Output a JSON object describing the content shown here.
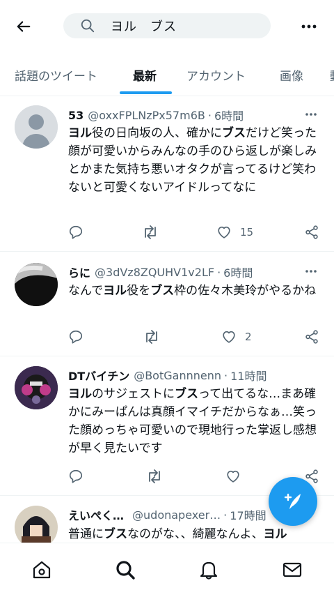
{
  "search": {
    "query": "ヨル　ブス"
  },
  "tabs": [
    {
      "label": "話題のツイート"
    },
    {
      "label": "最新"
    },
    {
      "label": "アカウント"
    },
    {
      "label": "画像"
    },
    {
      "label": "動"
    }
  ],
  "active_tab": "最新",
  "tweets": [
    {
      "name": "53",
      "handle": "@oxxFPLNzPx57m6B",
      "time": "6時間",
      "text_parts": [
        {
          "t": "ヨル",
          "b": true
        },
        {
          "t": "役の日向坂の人、確かに",
          "b": false
        },
        {
          "t": "ブス",
          "b": true
        },
        {
          "t": "だけど笑った顔が可愛いからみんなの手のひら返しが楽しみとかまた気持ち悪いオタクが言ってるけど笑わないと可愛くないアイドルってなに",
          "b": false
        }
      ],
      "likes": "15",
      "avatar": "default-avatar"
    },
    {
      "name": "らに",
      "handle": "@3dVz8ZQUHV1v2LF",
      "time": "6時間",
      "text_parts": [
        {
          "t": "なんで",
          "b": false
        },
        {
          "t": "ヨル",
          "b": true
        },
        {
          "t": "役を",
          "b": false
        },
        {
          "t": "ブス",
          "b": true
        },
        {
          "t": "枠の佐々木美玲がやるかね",
          "b": false
        }
      ],
      "likes": "2",
      "avatar": "dark-photo-avatar"
    },
    {
      "name": "DTバイチン",
      "handle": "@BotGannnenn",
      "time": "11時間",
      "text_parts": [
        {
          "t": "ヨル",
          "b": true
        },
        {
          "t": "のサジェストに",
          "b": false
        },
        {
          "t": "ブス",
          "b": true
        },
        {
          "t": "って出てるな…まあ確かにみーぱんは真顔イマイチだからなぁ…笑った顔めっちゃ可愛いので現地行った掌返し感想が早く見たいです",
          "b": false
        }
      ],
      "likes": "",
      "avatar": "character-avatar"
    },
    {
      "name": "えいぺく…",
      "handle": "@udonapexer…",
      "time": "17時間",
      "text_parts": [
        {
          "t": "普通に",
          "b": false
        },
        {
          "t": "ブス",
          "b": true
        },
        {
          "t": "なのがな、、綺麗なんよ、",
          "b": false
        },
        {
          "t": "ヨル",
          "b": true
        }
      ],
      "likes": "",
      "avatar": "anime-avatar"
    }
  ],
  "colors": {
    "accent": "#1d9bf0",
    "muted": "#536471",
    "text": "#0f1419"
  },
  "icons": {
    "header": [
      "back-arrow-icon",
      "search-icon",
      "more-icon"
    ],
    "actions": [
      "reply-icon",
      "retweet-icon",
      "like-icon",
      "share-icon"
    ],
    "nav": [
      "home-icon",
      "search-icon",
      "notifications-icon",
      "messages-icon"
    ],
    "fab": "compose-icon"
  }
}
